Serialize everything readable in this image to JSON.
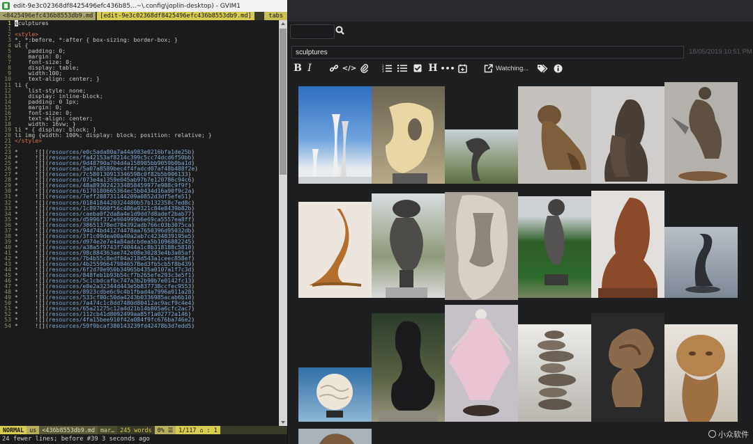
{
  "vim": {
    "window_title": "edit-9e3c02368df8425496efc436b85...~\\.config\\joplin-desktop) - GVIM1",
    "tabs": [
      {
        "label": "<8425496efc436b8553db9.md",
        "active": false
      },
      {
        "label": "[edit-9e3c02368df8425496efc436b8553db9.md]",
        "active": true
      }
    ],
    "tabs_label": "tabs",
    "lines": [
      {
        "n": "1",
        "t": "sculptures",
        "kind": "plain",
        "current": true
      },
      {
        "n": "1",
        "t": "",
        "kind": "plain"
      },
      {
        "n": "2",
        "t": "<style>",
        "kind": "tag"
      },
      {
        "n": "3",
        "t": "*, *:before, *:after { box-sizing: border-box; }",
        "kind": "css"
      },
      {
        "n": "4",
        "t": "ul {",
        "kind": "css"
      },
      {
        "n": "5",
        "t": "    padding: 0;",
        "kind": "css"
      },
      {
        "n": "6",
        "t": "    margin: 0;",
        "kind": "css"
      },
      {
        "n": "7",
        "t": "    font-size: 0;",
        "kind": "css"
      },
      {
        "n": "8",
        "t": "    display: table;",
        "kind": "css"
      },
      {
        "n": "9",
        "t": "    width:100;",
        "kind": "css"
      },
      {
        "n": "10",
        "t": "    text-align: center; }",
        "kind": "css"
      },
      {
        "n": "11",
        "t": "li {",
        "kind": "css"
      },
      {
        "n": "12",
        "t": "    list-style: none;",
        "kind": "css"
      },
      {
        "n": "13",
        "t": "    display: inline-block;",
        "kind": "css"
      },
      {
        "n": "14",
        "t": "    padding: 0 1px;",
        "kind": "css"
      },
      {
        "n": "15",
        "t": "    margin: 0;",
        "kind": "css"
      },
      {
        "n": "16",
        "t": "    font-size: 0;",
        "kind": "css"
      },
      {
        "n": "17",
        "t": "    text-align: center;",
        "kind": "css"
      },
      {
        "n": "18",
        "t": "    width: 16vw; }",
        "kind": "css"
      },
      {
        "n": "19",
        "t": "li * { display: block; }",
        "kind": "css"
      },
      {
        "n": "20",
        "t": "li img {width: 100%; display: block; position: relative; }",
        "kind": "css"
      },
      {
        "n": "21",
        "t": "</style>",
        "kind": "tag"
      },
      {
        "n": "22",
        "t": "",
        "kind": "plain"
      },
      {
        "n": "23",
        "t": "*     ![](resources/e0c5ada80a7a44a983e0216bfa1de25b)",
        "kind": "md"
      },
      {
        "n": "24",
        "t": "*     ![](resources/fa42153af8214c399c5cc74dcd6f50bb)",
        "kind": "md"
      },
      {
        "n": "25",
        "t": "*     ![](resources/9d48790a704d4a158905bb9059b0ba1d)",
        "kind": "md"
      },
      {
        "n": "26",
        "t": "*     ![](resources/5a07a8589bec4f4fadcd07af48b488f2e)",
        "kind": "md"
      },
      {
        "n": "27",
        "t": "*     ![](resources/7c58013091334659Bc0f82b5b906133)",
        "kind": "md"
      },
      {
        "n": "28",
        "t": "*     ![](resources/073e4a1359e045ab97b7e120786c94c6)",
        "kind": "md"
      },
      {
        "n": "29",
        "t": "*     ![](resources/48a8930242334858459977e988c9f9f)",
        "kind": "md"
      },
      {
        "n": "30",
        "t": "*     ![](resources/6170180665364ec5b0434d16a90f9c2a)",
        "kind": "md"
      },
      {
        "n": "31",
        "t": "*     ![](resources/7eff288731144209a0852d3df5efe51)",
        "kind": "md"
      },
      {
        "n": "32",
        "t": "*     ![](resources/0184184420324480b57b132358c7ed8c)",
        "kind": "md"
      },
      {
        "n": "33",
        "t": "*     ![](resources/1c897660f56c486a9321c84e8439b82b)",
        "kind": "md"
      },
      {
        "n": "34",
        "t": "*     ![](resources/caeba0f2da8a4e1d9dd7d8adef2bab77)",
        "kind": "md"
      },
      {
        "n": "35",
        "t": "*     ![](resources/d5996f372e904999b6e69ca5557ea8ff)",
        "kind": "md"
      },
      {
        "n": "36",
        "t": "*     ![](resources/38651378ed784392adb766c03b3075ca)",
        "kind": "md"
      },
      {
        "n": "37",
        "t": "*     ![](resources/94d74bd41274478aa7650396d95032db)",
        "kind": "md"
      },
      {
        "n": "38",
        "t": "*     ![](resources/3f1c09dea00a40a2ab7c4234839195e5)",
        "kind": "md"
      },
      {
        "n": "39",
        "t": "*     ![](resources/d974e2e7e4a84adcbdea5b1096882245)",
        "kind": "md"
      },
      {
        "n": "40",
        "t": "*     ![](resources/a38a5f9743f74044a1c8b318188c5810)",
        "kind": "md"
      },
      {
        "n": "41",
        "t": "*     ![](resources/98c884363ae742e08e30283e4b3a05af)",
        "kind": "md"
      },
      {
        "n": "42",
        "t": "*     ![](resources/7b4b55c8edf04a218d543a1ceec858ef)",
        "kind": "md"
      },
      {
        "n": "43",
        "t": "*     ![](resources/4b25596647984657Bed3fb5cb5f8b439)",
        "kind": "md"
      },
      {
        "n": "44",
        "t": "*     ![](resources/6f2d70e950b34965b435a0107a1f7c3d)",
        "kind": "md"
      },
      {
        "n": "45",
        "t": "*     ![](resources/848feb1b93b54cf7b265efe293c3e5f1)",
        "kind": "md"
      },
      {
        "n": "46",
        "t": "*     ![](resources/5c1cbdcafbc747a3b2b90b7e0142fc13)",
        "kind": "md"
      },
      {
        "n": "47",
        "t": "*     ![](resources/e8e2a32344d443e5b83773Bccfec9553)",
        "kind": "md"
      },
      {
        "n": "48",
        "t": "*     ![](resources/8923cdbe6c9c4b1fbad4a7996a911a28)",
        "kind": "md"
      },
      {
        "n": "49",
        "t": "*     ![](resources/533cf80c50da4243b0336985acab6b10)",
        "kind": "md"
      },
      {
        "n": "50",
        "t": "*     ![](resources/7a474c1c8dd7480d80412ac9acf9c4e4)",
        "kind": "md"
      },
      {
        "n": "51",
        "t": "*     ![](resources/65a21275c12a4d21b14b805a6cfc2ac7)",
        "kind": "md"
      },
      {
        "n": "52",
        "t": "*     ![](resources/112cb41d8092499aa85f1a02772a146)",
        "kind": "md"
      },
      {
        "n": "53",
        "t": "*     ![](resources/4fa15bee910f42a084f9fc676ba746e2)",
        "kind": "md"
      },
      {
        "n": "54",
        "t": "*     ![](resources/59f9bcaf380143239fd42478b3d7edd5)",
        "kind": "md"
      }
    ],
    "status": {
      "mode": "NORMAL",
      "enc": "us",
      "file": "<436b8553db9.md",
      "filetype": "mar…",
      "words": "245 words",
      "percent": "0% ☰",
      "position": "1/117 ⌂ : 1"
    },
    "cmdline": "24 fewer lines; before #39  3 seconds ago"
  },
  "joplin": {
    "note_title": "sculptures",
    "date": "18/05/2019 10:51 PM",
    "toolbar": {
      "watching_label": "Watching..."
    },
    "icons": [
      "bold-icon",
      "italic-icon",
      "link-icon",
      "code-icon",
      "attachment-icon",
      "numbered-list-icon",
      "bulleted-list-icon",
      "checkbox-icon",
      "heading-icon",
      "horizontal-rule-icon",
      "insert-date-icon",
      "external-edit-icon",
      "tags-icon",
      "info-icon"
    ],
    "sculptures": [
      {
        "name": "sculpture-twin-towers"
      },
      {
        "name": "sculpture-abstract-stone"
      },
      {
        "name": "sculpture-garden-figure"
      },
      {
        "name": "sculpture-bronze-lion-cub"
      },
      {
        "name": "sculpture-bronze-figures"
      },
      {
        "name": "sculpture-bronze-warrior"
      },
      {
        "name": "sculpture-wood-wave"
      },
      {
        "name": "sculpture-stone-figure"
      },
      {
        "name": "sculpture-carved-relief"
      },
      {
        "name": "sculpture-park-figure"
      },
      {
        "name": "sculpture-cloaked-figure"
      },
      {
        "name": "sculpture-chrome-wave"
      },
      {
        "name": "sculpture-coral-sphere"
      },
      {
        "name": "sculpture-dark-abstract"
      },
      {
        "name": "sculpture-dancer"
      },
      {
        "name": "sculpture-stacked-stones"
      },
      {
        "name": "sculpture-wood-swirl"
      },
      {
        "name": "sculpture-lion-head"
      },
      {
        "name": "sculpture-partial"
      }
    ]
  },
  "watermark": {
    "text": "小众软件"
  }
}
